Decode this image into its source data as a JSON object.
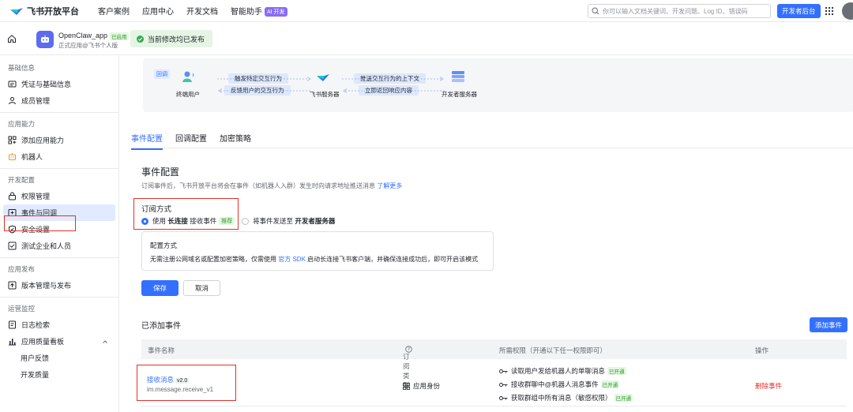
{
  "topnav": {
    "logo_text": "飞书开放平台",
    "links": [
      "客户案例",
      "应用中心",
      "开发文档",
      "智能助手"
    ],
    "ai_badge": "AI 开发",
    "search_placeholder": "你可以输入文档关键词、开发问题、Log ID、错误码",
    "dev_console": "开发者后台"
  },
  "appbar": {
    "app_name": "OpenClaw_app",
    "app_tag": "已启用",
    "app_sub": "正式应用@飞书个人版",
    "toast": "当前修改均已发布"
  },
  "sidebar": {
    "groups": [
      {
        "title": "基础信息",
        "items": [
          {
            "label": "凭证与基础信息",
            "icon": "credential-icon"
          },
          {
            "label": "成员管理",
            "icon": "member-icon"
          }
        ]
      },
      {
        "title": "应用能力",
        "items": [
          {
            "label": "添加应用能力",
            "icon": "grid-plus-icon"
          },
          {
            "label": "机器人",
            "icon": "robot-icon"
          }
        ]
      },
      {
        "title": "开发配置",
        "items": [
          {
            "label": "权限管理",
            "icon": "lock-icon"
          },
          {
            "label": "事件与回调",
            "icon": "event-icon",
            "active": true
          },
          {
            "label": "安全设置",
            "icon": "shield-icon"
          },
          {
            "label": "测试企业和人员",
            "icon": "test-icon"
          }
        ]
      },
      {
        "title": "应用发布",
        "items": [
          {
            "label": "版本管理与发布",
            "icon": "publish-icon"
          }
        ]
      },
      {
        "title": "运营监控",
        "items": [
          {
            "label": "日志检索",
            "icon": "log-icon"
          },
          {
            "label": "应用质量看板",
            "icon": "chart-icon"
          },
          {
            "label": "用户反馈",
            "sub": true
          },
          {
            "label": "开发质量",
            "sub": true
          }
        ]
      }
    ]
  },
  "flow": {
    "tag": "回调",
    "nodes": [
      "终端用户",
      "飞书服务器",
      "开发者服务器"
    ],
    "pills": [
      "触发特定交互行为",
      "反馈用户的交互行为",
      "推送交互行为的上下文",
      "立即返回响应内容"
    ]
  },
  "tabs": [
    "事件配置",
    "回调配置",
    "加密策略"
  ],
  "event_config": {
    "title": "事件配置",
    "desc": "订阅事件后，飞书开放平台将会在事件（如机器人入群）发生时向请求地址推送消息",
    "desc_link": "了解更多",
    "sub_title": "订阅方式",
    "option1_prefix": "使用",
    "option1_bold": "长连接",
    "option1_suffix": "接收事件",
    "option1_tag": "推荐",
    "option2_prefix": "将事件发送至",
    "option2_bold": "开发者服务器",
    "cfg_title": "配置方式",
    "cfg_text_1": "无需注册公网域名或配置加密策略，仅需使用",
    "cfg_link": "官方 SDK",
    "cfg_text_2": "启动长连接飞书客户端，并确保连接成功后，即可开启该模式",
    "save": "保存",
    "cancel": "取消"
  },
  "added_events": {
    "title": "已添加事件",
    "add_button": "添加事件",
    "columns": [
      "事件名称",
      "订阅类型",
      "所需权限（开通以下任一权限即可）",
      "操作"
    ],
    "rows": [
      {
        "name": "接收消息",
        "version": "v2.0",
        "id": "im.message.receive_v1",
        "type": "应用身份",
        "permissions": [
          {
            "label": "读取用户发给机器人的单聊消息",
            "status": "已开通"
          },
          {
            "label": "接收群聊中@机器人消息事件",
            "status": "已开通"
          },
          {
            "label": "获取群组中所有消息（敏感权限）",
            "status": "已开通"
          }
        ],
        "action": "删除事件"
      }
    ]
  },
  "colors": {
    "accent": "#3370ff",
    "danger": "#e0322b",
    "success": "#2ea121"
  }
}
